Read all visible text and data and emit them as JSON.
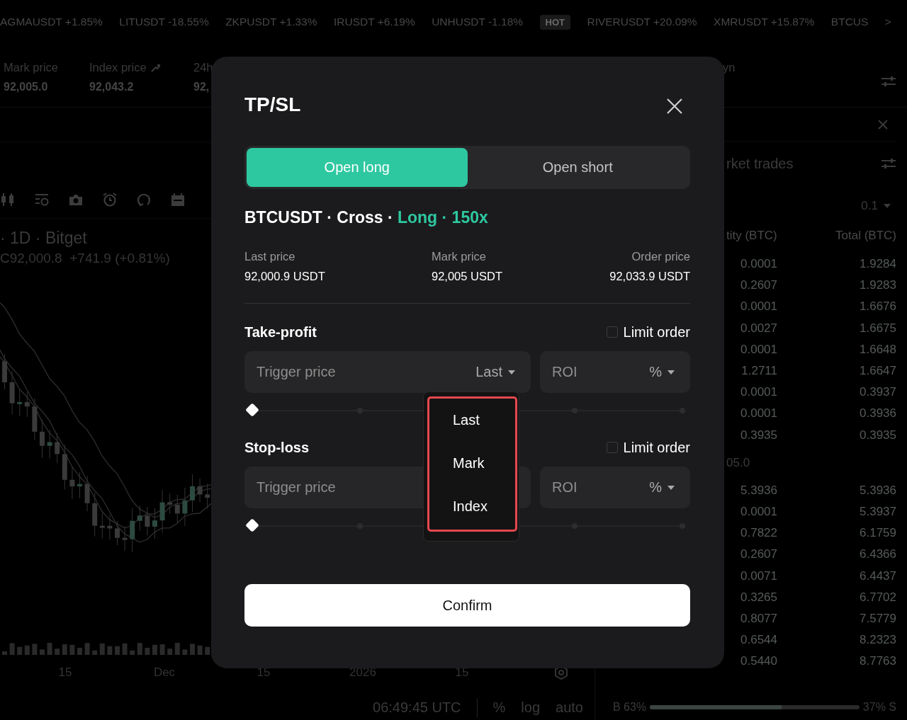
{
  "ticker": {
    "items": [
      {
        "kind": "pair",
        "symbol": "AGMAUSDT",
        "change": "+1.85%"
      },
      {
        "kind": "pair",
        "symbol": "LITUSDT",
        "change": "-18.55%"
      },
      {
        "kind": "pair",
        "symbol": "ZKPUSDT",
        "change": "+1.33%"
      },
      {
        "kind": "pair",
        "symbol": "IRUSDT",
        "change": "+6.19%"
      },
      {
        "kind": "pair",
        "symbol": "UNHUSDT",
        "change": "-1.18%"
      },
      {
        "kind": "badge",
        "label": "HOT"
      },
      {
        "kind": "pair",
        "symbol": "RIVERUSDT",
        "change": "+20.09%"
      },
      {
        "kind": "pair",
        "symbol": "XMRUSDT",
        "change": "+15.87%"
      },
      {
        "kind": "pair",
        "symbol": "BTCUS"
      }
    ],
    "more": ">"
  },
  "stats": {
    "items": [
      {
        "kind": "plain",
        "label": "Mark price",
        "value": "92,005.0"
      },
      {
        "kind": "linked",
        "label": "Index price",
        "value": "92,043.2"
      },
      {
        "kind": "plain",
        "label": "24h",
        "value": "92,"
      }
    ],
    "right_label": "yn"
  },
  "chart": {
    "title": "· 1D · Bitget",
    "ohlc": "C92,000.8  +741.9 (+0.81%)",
    "x_axis": [
      "15",
      "Dec",
      "15",
      "2026",
      "15"
    ]
  },
  "chart_footer": {
    "time": "06:49:45 UTC",
    "toggles": [
      "%",
      "log",
      "auto"
    ]
  },
  "order_book": {
    "title": "rket trades",
    "precision": "0.1",
    "columns": [
      "tity (BTC)",
      "Total (BTC)"
    ],
    "asks": [
      {
        "quantity": "0.0001",
        "total": "1.9284"
      },
      {
        "quantity": "0.2607",
        "total": "1.9283"
      },
      {
        "quantity": "0.0001",
        "total": "1.6676"
      },
      {
        "quantity": "0.0027",
        "total": "1.6675"
      },
      {
        "quantity": "0.0001",
        "total": "1.6648"
      },
      {
        "quantity": "1.2711",
        "total": "1.6647"
      },
      {
        "quantity": "0.0001",
        "total": "0.3937"
      },
      {
        "quantity": "0.0001",
        "total": "0.3936"
      },
      {
        "quantity": "0.3935",
        "total": "0.3935"
      }
    ],
    "mid_price": "05.0",
    "bids": [
      {
        "quantity": "5.3936",
        "total": "5.3936"
      },
      {
        "quantity": "0.0001",
        "total": "5.3937"
      },
      {
        "quantity": "0.7822",
        "total": "6.1759"
      },
      {
        "quantity": "0.2607",
        "total": "6.4366"
      },
      {
        "quantity": "0.0071",
        "total": "6.4437"
      },
      {
        "quantity": "0.3265",
        "total": "6.7702"
      },
      {
        "quantity": "0.8077",
        "total": "7.5779"
      },
      {
        "quantity": "0.6544",
        "total": "8.2323"
      },
      {
        "quantity": "0.5440",
        "total": "8.7763"
      }
    ],
    "ratio": {
      "buy_label": "B 63%",
      "sell_label": "37% S",
      "level": 0.63
    }
  },
  "modal": {
    "title": "TP/SL",
    "tabs": [
      {
        "label": "Open long",
        "selected": true
      },
      {
        "label": "Open short",
        "selected": false
      }
    ],
    "instrument": "BTCUSDT · Cross ·",
    "position": "Long · 150x",
    "prices": [
      {
        "label": "Last price",
        "value": "92,000.9 USDT"
      },
      {
        "label": "Mark price",
        "value": "92,005 USDT"
      },
      {
        "label": "Order price",
        "value": "92,033.9 USDT"
      }
    ],
    "sections": [
      {
        "title": "Take-profit",
        "limit_order": {
          "label": "Limit order",
          "checked": false
        },
        "trigger": {
          "placeholder": "Trigger price",
          "price_type": "Last"
        },
        "roi": {
          "placeholder": "ROI",
          "unit": "%"
        },
        "slider": {
          "level": 0
        }
      },
      {
        "title": "Stop-loss",
        "limit_order": {
          "label": "Limit order",
          "checked": false
        },
        "trigger": {
          "placeholder": "Trigger price"
        },
        "roi": {
          "placeholder": "ROI",
          "unit": "%"
        },
        "slider": {
          "level": 0
        }
      }
    ],
    "price_type_menu": {
      "options": [
        "Last",
        "Mark",
        "Index"
      ]
    },
    "confirm": "Confirm"
  }
}
